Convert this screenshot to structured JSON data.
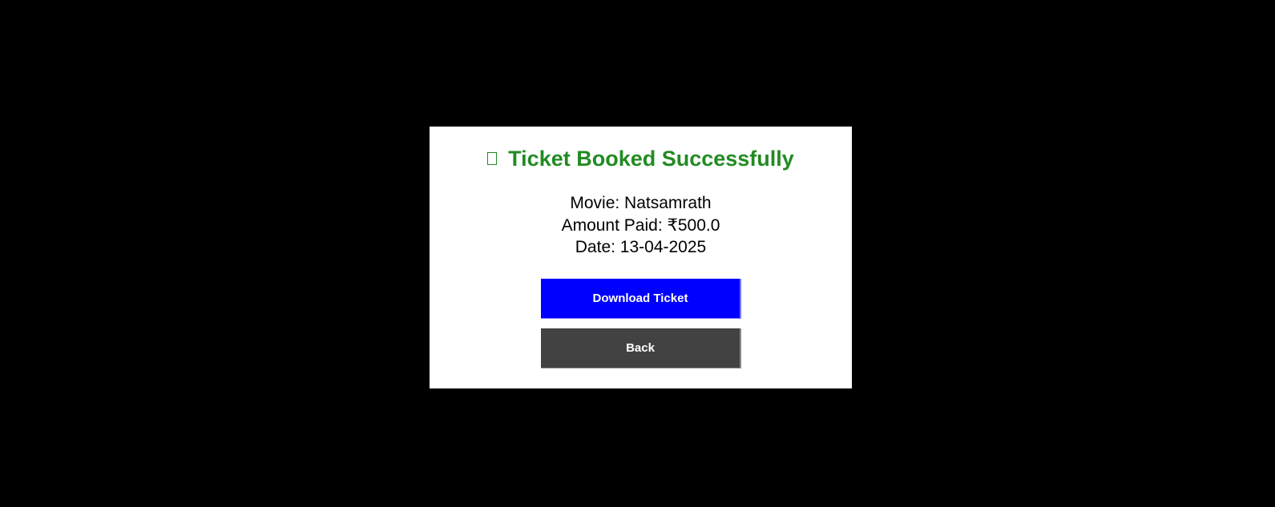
{
  "dialog": {
    "title": "Ticket Booked Successfully",
    "title_icon": "missing-glyph-icon",
    "movie_line": "Movie: Natsamrath",
    "amount_line": "Amount Paid: ₹500.0",
    "date_line": "Date: 13-04-2025",
    "download_label": "Download Ticket",
    "back_label": "Back"
  },
  "colors": {
    "background": "#000000",
    "dialog_background": "#ffffff",
    "title": "#228b22",
    "download_button": "#0000ff",
    "back_button": "#424242",
    "button_text": "#ffffff"
  }
}
